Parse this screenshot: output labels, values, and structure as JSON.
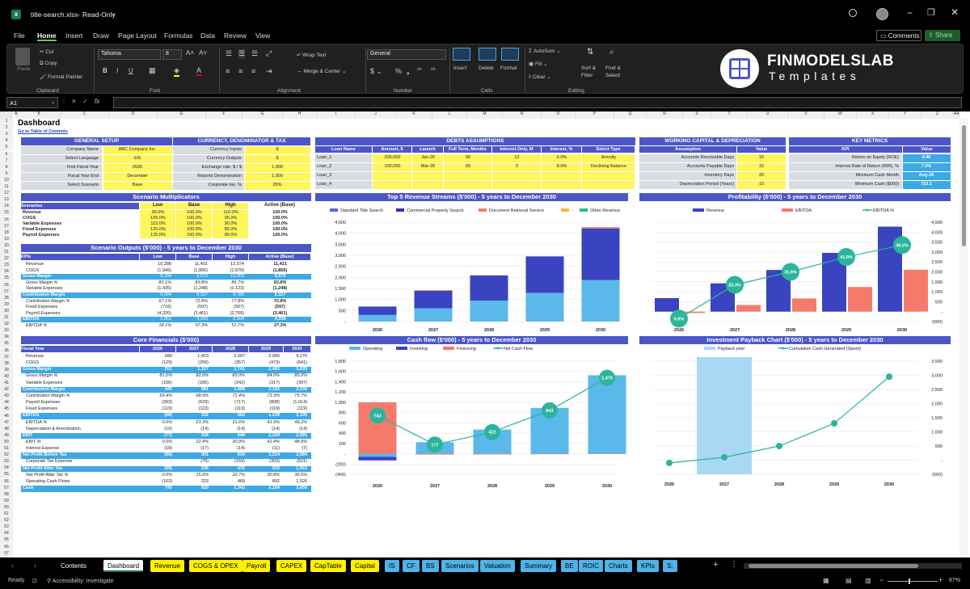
{
  "app": {
    "filename": "title-search.xlsx",
    "mode": "Read-Only",
    "comments": "Comments",
    "share": "Share"
  },
  "menu": [
    "File",
    "Home",
    "Insert",
    "Draw",
    "Page Layout",
    "Formulas",
    "Data",
    "Review",
    "View"
  ],
  "ribbon": {
    "clipboard": {
      "paste": "Paste",
      "cut": "Cut",
      "copy": "Copy",
      "format_painter": "Format Painter",
      "group": "Clipboard"
    },
    "font": {
      "name": "Tahoma",
      "size": "8",
      "group": "Font"
    },
    "alignment": {
      "wrap": "Wrap Text",
      "merge": "Merge & Center",
      "group": "Alignment"
    },
    "number": {
      "format": "General",
      "group": "Number"
    },
    "cells": {
      "insert": "Insert",
      "delete": "Delete",
      "format": "Format",
      "group": "Cells"
    },
    "editing": {
      "autosum": "AutoSum",
      "fill": "Fill",
      "clear": "Clear",
      "sort": "Sort & Filter",
      "find": "Find & Select",
      "group": "Editing"
    }
  },
  "logo": {
    "brand": "FINMODELSLAB",
    "sub": "Templates"
  },
  "formula_bar": {
    "cell": "A1",
    "fx": "fx"
  },
  "columns": [
    "A",
    "B",
    "C",
    "D",
    "E",
    "F",
    "G",
    "H",
    "I",
    "J",
    "K",
    "L",
    "M",
    "N",
    "O",
    "P",
    "Q",
    "R",
    "S",
    "T",
    "U",
    "V",
    "W",
    "X",
    "Y",
    "Z",
    "AA",
    "AB"
  ],
  "sheet": {
    "title": "Dashboard",
    "toc_link": "Go to Table of Contents",
    "general_setup": {
      "header": "GENERAL SETUP",
      "rows": [
        [
          "Company Name",
          "ABC Company Inc."
        ],
        [
          "Select Language",
          "EN"
        ],
        [
          "First Fiscal Year",
          "2026"
        ],
        [
          "Fiscal Year End",
          "December"
        ],
        [
          "Select Scenario",
          "Base"
        ]
      ]
    },
    "currency": {
      "header": "CURRENCY, DENOMINATOR & TAX",
      "rows": [
        [
          "Currency Inputs",
          "$"
        ],
        [
          "Currency Outputs",
          "$"
        ],
        [
          "Exchange rate, $ / $",
          "1.000"
        ],
        [
          "Reports Denomination",
          "1,000"
        ],
        [
          "Corporate tax, %",
          "25%"
        ]
      ]
    },
    "debts": {
      "header": "DEBTS ASSUMPTIONS",
      "cols": [
        "Loan Name",
        "Amount, $",
        "Launch",
        "Full Term, Months",
        "Interest-Only, M",
        "Interest, %",
        "Select Type"
      ],
      "rows": [
        [
          "Loan_1",
          "200,000",
          "Jan-26",
          "90",
          "12",
          "6.0%",
          "Annuity"
        ],
        [
          "Loan_2",
          "100,000",
          "Mar-26",
          "60",
          "0",
          "8.0%",
          "Declining Balance"
        ],
        [
          "Loan_3",
          "",
          "",
          "",
          "",
          "",
          ""
        ],
        [
          "Loan_4",
          "",
          "",
          "",
          "",
          "",
          ""
        ]
      ]
    },
    "wc": {
      "header": "WORKING CAPITAL & DEPRECIATION",
      "cols": [
        "Assumption",
        "Value"
      ],
      "rows": [
        [
          "Accounts Receivable Days",
          "15"
        ],
        [
          "Accounts Payable Days",
          "15"
        ],
        [
          "Inventory Days",
          "20"
        ],
        [
          "Depreciation Period (Years)",
          "10"
        ]
      ]
    },
    "kpi": {
      "header": "KEY METRICS",
      "cols": [
        "KPI",
        "Value"
      ],
      "rows": [
        [
          "Return on Equity (ROE)",
          "4.40"
        ],
        [
          "Internal Rate of Return (IRR), %",
          "7.0%"
        ],
        [
          "Minimum Cash Month",
          "Aug-26"
        ],
        [
          "Minimum Cash ($000)",
          "723.1"
        ]
      ]
    },
    "multipliers": {
      "header": "Scenario Multiplicators",
      "cols": [
        "Scenarios",
        "Low",
        "Base",
        "High",
        "Active (Base)"
      ],
      "rows": [
        [
          "Revenue",
          "90.0%",
          "100.0%",
          "110.0%",
          "100.0%"
        ],
        [
          "COGS",
          "105.0%",
          "100.0%",
          "95.0%",
          "100.0%"
        ],
        [
          "Variable Expenses",
          "115.0%",
          "100.0%",
          "90.0%",
          "100.0%"
        ],
        [
          "Fixed Expenses",
          "120.0%",
          "100.0%",
          "85.0%",
          "100.0%"
        ],
        [
          "Payroll Expenses",
          "125.0%",
          "100.0%",
          "80.0%",
          "100.0%"
        ]
      ]
    },
    "scenario_outputs": {
      "header": "Scenario Outputs ($'000) - 5 years to December 2030",
      "cols": [
        "KPIs",
        "Low",
        "Base",
        "High",
        "Active (Base)"
      ],
      "rows": [
        [
          "Revenue",
          "10,288",
          "11,431",
          "12,574",
          "11,431"
        ],
        [
          "COGS",
          "(1,949)",
          "(1,856)",
          "(1,670)",
          "(1,856)"
        ],
        [
          "Gross Margin",
          "8,339",
          "9,575",
          "10,903",
          "9,575"
        ],
        [
          "Gross Margin %",
          "81.1%",
          "83.8%",
          "86.7%",
          "83.8%"
        ],
        [
          "Variable Expenses",
          "(1,435)",
          "(1,248)",
          "(1,123)",
          "(1,248)"
        ],
        [
          "Contribution Margin",
          "6,904",
          "8,327",
          "9,780",
          "8,327"
        ],
        [
          "Contribution Margin %",
          "67.1%",
          "72.8%",
          "77.8%",
          "72.8%"
        ],
        [
          "Fixed Expenses",
          "(716)",
          "(597)",
          "(507)",
          "(597)"
        ],
        [
          "Payroll Expenses",
          "(4,326)",
          "(3,461)",
          "(2,769)",
          "(3,461)"
        ],
        [
          "EBITDA",
          "1,862",
          "4,269",
          "6,504",
          "4,269"
        ],
        [
          "EBITDA %",
          "18.1%",
          "37.3%",
          "51.7%",
          "37.3%"
        ]
      ]
    },
    "core": {
      "header": "Core Financials ($'000)",
      "cols": [
        "Fiscal Year",
        "2026",
        "2027",
        "2028",
        "2029",
        "2030"
      ],
      "rows": [
        [
          "Revenue",
          "680",
          "1,423",
          "2,097",
          "2,955",
          "4,276"
        ],
        [
          "COGS",
          "(129)",
          "(256)",
          "(357)",
          "(473)",
          "(641)"
        ],
        [
          "Gross Margin",
          "551",
          "1,167",
          "1,741",
          "2,482",
          "3,635"
        ],
        [
          "Gross Margin %",
          "81.0%",
          "82.0%",
          "83.0%",
          "84.0%",
          "85.0%"
        ],
        [
          "Variable Expenses",
          "(106)",
          "(186)",
          "(242)",
          "(317)",
          "(397)"
        ],
        [
          "Contribution Margin",
          "445",
          "981",
          "1,498",
          "2,165",
          "3,238"
        ],
        [
          "Contribution Margin %",
          "65.4%",
          "68.9%",
          "71.4%",
          "73.3%",
          "75.7%"
        ],
        [
          "Payroll Expenses",
          "(393)",
          "(529)",
          "(717)",
          "(808)",
          "(1,014)"
        ],
        [
          "Fixed Expenses",
          "(119)",
          "(119)",
          "(119)",
          "(119)",
          "(119)"
        ],
        [
          "EBITDA",
          "(68)",
          "332",
          "662",
          "1,238",
          "2,105"
        ],
        [
          "EBITDA %",
          "0.0%",
          "23.3%",
          "31.6%",
          "41.9%",
          "49.2%"
        ],
        [
          "Depreciation & Amortization",
          "(10)",
          "(14)",
          "(14)",
          "(14)",
          "(14)"
        ],
        [
          "EBIT",
          "(77)",
          "318",
          "648",
          "1,224",
          "2,091"
        ],
        [
          "EBIT %",
          "0.0%",
          "22.4%",
          "30.9%",
          "41.4%",
          "48.9%"
        ],
        [
          "Interest Expense",
          "(18)",
          "(17)",
          "(14)",
          "(11)",
          "(7)"
        ],
        [
          "Net Profit Before Tax",
          "(96)",
          "301",
          "634",
          "1,214",
          "2,084"
        ],
        [
          "Corporate Tax Expense",
          "-",
          "(75)",
          "(159)",
          "(303)",
          "(521)"
        ],
        [
          "Net Profit After Tax",
          "(96)",
          "226",
          "476",
          "910",
          "1,563"
        ],
        [
          "Net Profit After Tax %",
          "0.0%",
          "15.9%",
          "22.7%",
          "30.8%",
          "36.5%"
        ],
        [
          "Operating Cash Flows",
          "(103)",
          "223",
          "469",
          "892",
          "1,526"
        ],
        [
          "Cash",
          "743",
          "920",
          "1,342",
          "2,184",
          "3,659"
        ]
      ]
    }
  },
  "chart_data": [
    {
      "type": "bar",
      "title": "Top 5 Revenue Streams ($'000) - 5 years to December 2030",
      "categories": [
        "2026",
        "2027",
        "2028",
        "2029",
        "2030"
      ],
      "series": [
        {
          "name": "Standard Title Search",
          "values": [
            300,
            600,
            950,
            1300,
            1880
          ]
        },
        {
          "name": "Commercial Property Search",
          "values": [
            380,
            790,
            1140,
            1650,
            2340
          ]
        },
        {
          "name": "Document Retrieval Service",
          "values": [
            0,
            30,
            7,
            5,
            56
          ]
        },
        {
          "name": "-",
          "values": [
            0,
            0,
            0,
            0,
            0
          ]
        },
        {
          "name": "Other Revenue",
          "values": [
            0,
            0,
            0,
            0,
            0
          ]
        }
      ],
      "ylim": [
        0,
        4500
      ],
      "yticks": [
        "-",
        "500",
        "1,000",
        "1,500",
        "2,000",
        "2,500",
        "3,000",
        "3,500",
        "4,000",
        "4,500"
      ]
    },
    {
      "type": "bar",
      "title": "Profitability ($'000) - 5 years to December 2030",
      "categories": [
        "2026",
        "2027",
        "2028",
        "2029",
        "2030"
      ],
      "series": [
        {
          "name": "Revenue",
          "values": [
            680,
            1423,
            2097,
            2955,
            4276
          ]
        },
        {
          "name": "EBITDA",
          "values": [
            -68,
            332,
            662,
            1238,
            2105
          ]
        },
        {
          "name": "EBITDA %",
          "values": [
            0.0,
            23.3,
            31.6,
            41.9,
            49.2
          ]
        }
      ],
      "labels": [
        "0.0%",
        "23.3%",
        "31.6%",
        "41.0%",
        "49.2%"
      ],
      "ylim": [
        -500,
        4500
      ],
      "yticks": [
        "(500)",
        "-",
        "500",
        "1,000",
        "1,500",
        "2,000",
        "2,500",
        "3,000",
        "3,500",
        "4,000",
        "4,500"
      ]
    },
    {
      "type": "bar",
      "title": "Cash flow ($'000) - 5 years to December 2030",
      "categories": [
        "2026",
        "2027",
        "2028",
        "2029",
        "2030"
      ],
      "series": [
        {
          "name": "Operating",
          "values": [
            -60,
            223,
            469,
            892,
            1526
          ]
        },
        {
          "name": "Investing",
          "values": [
            -70,
            0,
            0,
            0,
            0
          ]
        },
        {
          "name": "Financing",
          "values": [
            1000,
            -17,
            -14,
            -11,
            -7
          ]
        },
        {
          "name": "Net Cash Flow",
          "values": [
            743,
            177,
            422,
            843,
            1475
          ]
        }
      ],
      "ylim": [
        -400,
        1800
      ],
      "yticks": [
        "(400)",
        "(200)",
        "-",
        "200",
        "400",
        "600",
        "800",
        "1,000",
        "1,200",
        "1,400",
        "1,600",
        "1,800"
      ]
    },
    {
      "type": "line",
      "title": "Investment Payback Chart ($'000) - 5 years to December 2030",
      "categories": [
        "2026",
        "2027",
        "2028",
        "2029",
        "2030"
      ],
      "series": [
        {
          "name": "Payback year",
          "values": [
            0,
            1,
            0,
            0,
            0
          ]
        },
        {
          "name": "Cumulative Cash Generated (Spent)",
          "values": [
            -100,
            100,
            500,
            1300,
            2950
          ]
        }
      ],
      "ylim": [
        -500,
        3500
      ],
      "yticks": [
        "(500)",
        "-",
        "500",
        "1,000",
        "1,500",
        "2,000",
        "2,500",
        "3,000",
        "3,500"
      ]
    }
  ],
  "tabs": [
    {
      "label": "Contents",
      "color": "#000000",
      "fg": "#ffffff"
    },
    {
      "label": "Dashboard",
      "color": "#ffffff",
      "fg": "#000000"
    },
    {
      "label": "Revenue",
      "color": "#fff200",
      "fg": "#000000"
    },
    {
      "label": "COGS & OPEX",
      "color": "#fff200",
      "fg": "#000000"
    },
    {
      "label": "Payroll",
      "color": "#fff200",
      "fg": "#000000"
    },
    {
      "label": "CAPEX",
      "color": "#fff200",
      "fg": "#000000"
    },
    {
      "label": "CapTable",
      "color": "#fff200",
      "fg": "#000000"
    },
    {
      "label": "Capital",
      "color": "#fff200",
      "fg": "#000000"
    },
    {
      "label": "IS",
      "color": "#4fb3e8",
      "fg": "#000000"
    },
    {
      "label": "CF",
      "color": "#4fb3e8",
      "fg": "#000000"
    },
    {
      "label": "BS",
      "color": "#4fb3e8",
      "fg": "#000000"
    },
    {
      "label": "Scenarios",
      "color": "#4fb3e8",
      "fg": "#000000"
    },
    {
      "label": "Valuation",
      "color": "#4fb3e8",
      "fg": "#000000"
    },
    {
      "label": "Summary",
      "color": "#4fb3e8",
      "fg": "#000000"
    },
    {
      "label": "BE",
      "color": "#4fb3e8",
      "fg": "#000000"
    },
    {
      "label": "ROIC",
      "color": "#4fb3e8",
      "fg": "#000000"
    },
    {
      "label": "Charts",
      "color": "#4fb3e8",
      "fg": "#000000"
    },
    {
      "label": "KPIs",
      "color": "#4fb3e8",
      "fg": "#000000"
    },
    {
      "label": "S:",
      "color": "#4fb3e8",
      "fg": "#000000"
    }
  ],
  "status": {
    "ready": "Ready",
    "accessibility": "Accessibility: Investigate",
    "zoom": "87%"
  },
  "colors": {
    "bar": "#4b57c7",
    "highlight": "#3ca8e6",
    "yellow": "#fff55c",
    "orange": "#f47b6b",
    "teal": "#2bb59a",
    "lightblue": "#5bb8ea"
  }
}
